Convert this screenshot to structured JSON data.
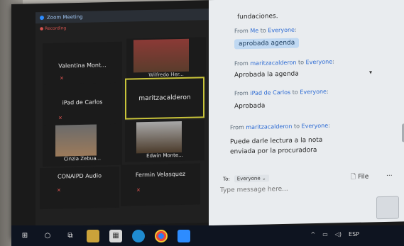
{
  "zoom": {
    "title": "Zoom Meeting",
    "recording": "Recording",
    "participants": [
      {
        "name": "Valentina  Mont...",
        "muted": true
      },
      {
        "name": "Wilfredo Her...",
        "muted": false
      },
      {
        "name": "iPad de Carlos",
        "muted": true
      },
      {
        "name": "maritzacalderon",
        "muted": false
      },
      {
        "name": "Cinzia Zebua...",
        "muted": true
      },
      {
        "name": "Edwin Monte...",
        "muted": true
      },
      {
        "name": "CONAIPD Audio",
        "muted": false
      },
      {
        "name": "Fermin Velasquez",
        "muted": false
      }
    ]
  },
  "chat": {
    "top_text": "fundaciones.",
    "messages": [
      {
        "from_prefix": "From ",
        "from": "Me",
        "to": "Everyone",
        "text": "aprobada agenda",
        "bubble": true
      },
      {
        "from_prefix": "From ",
        "from": "maritzacalderon",
        "to": "Everyone",
        "text": "Aprobada la agenda",
        "bubble": false
      },
      {
        "from_prefix": "From ",
        "from": "iPad de Carlos",
        "to": "Everyone",
        "text": "Aprobada",
        "bubble": false
      },
      {
        "from_prefix": "From ",
        "from": "maritzacalderon",
        "to": "Everyone",
        "text_line1": "Puede darle lectura a la nota",
        "text_line2": "enviada por la procuradora",
        "bubble": false
      }
    ],
    "to_label": "To:",
    "to_value": "Everyone",
    "file_label": "File",
    "more_label": "...",
    "placeholder": "Type message here..."
  },
  "taskbar": {
    "tray_text": "ESP",
    "icons": [
      "start-icon",
      "search-icon",
      "task-view-icon",
      "file-explorer-icon",
      "store-icon",
      "edge-icon",
      "chrome-icon",
      "zoom-icon"
    ]
  },
  "colors": {
    "chat_bg": "#e9ecef",
    "highlight_border": "#c9c43a",
    "link_blue": "#2d6bd3",
    "bubble": "#bfd8f2"
  }
}
